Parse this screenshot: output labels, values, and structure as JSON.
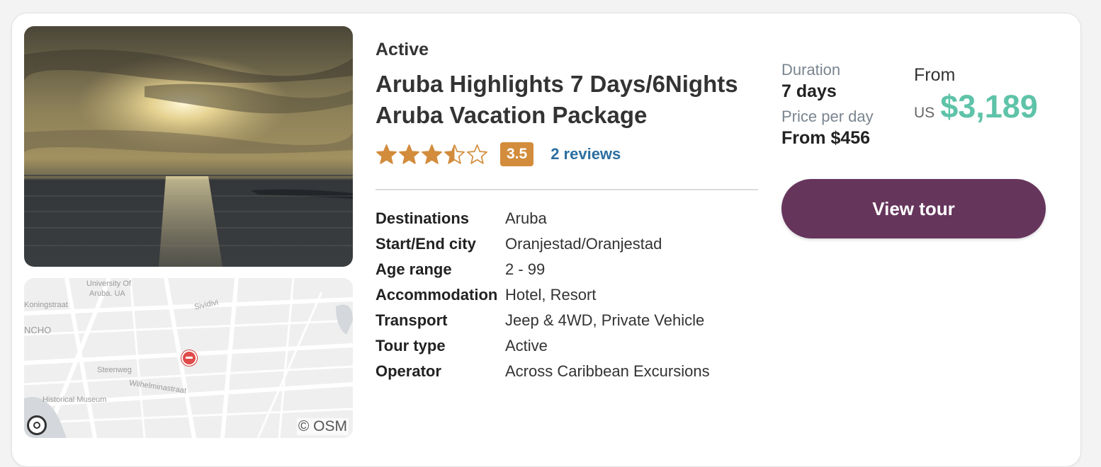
{
  "tour": {
    "type": "Active",
    "title": "Aruba Highlights 7 Days/6Nights Aruba Vacation Package",
    "rating": {
      "value": "3.5",
      "stars": 3.5,
      "max_stars": 5,
      "reviews_label": "2 reviews"
    },
    "details": [
      {
        "label": "Destinations",
        "value": "Aruba"
      },
      {
        "label": "Start/End city",
        "value": "Oranjestad/Oranjestad"
      },
      {
        "label": "Age range",
        "value": "2 - 99"
      },
      {
        "label": "Accommodation",
        "value": "Hotel, Resort"
      },
      {
        "label": "Transport",
        "value": "Jeep & 4WD, Private Vehicle"
      },
      {
        "label": "Tour type",
        "value": "Active"
      },
      {
        "label": "Operator",
        "value": "Across Caribbean Excursions"
      }
    ],
    "duration_label": "Duration",
    "duration_value": "7 days",
    "price_per_day_label": "Price per day",
    "price_per_day_value": "From $456",
    "from_label": "From",
    "currency": "US",
    "price": "$3,189",
    "button_label": "View tour"
  },
  "map": {
    "labels": {
      "university": "University Of",
      "university2": "Aruba. UA",
      "koningstraat": "Koningstraat",
      "rancho": "NCHO",
      "sividivi": "Sividivi",
      "steenweg": "Steenweg",
      "wilhelminastraat": "Wilhelminastraat",
      "museum": "Historical Museum"
    },
    "credit": "© OSM"
  },
  "colors": {
    "accent_price": "#5ec3a8",
    "button": "#66355c",
    "star": "#d28c3c",
    "badge": "#d28c3c",
    "link": "#2c6ea0"
  }
}
